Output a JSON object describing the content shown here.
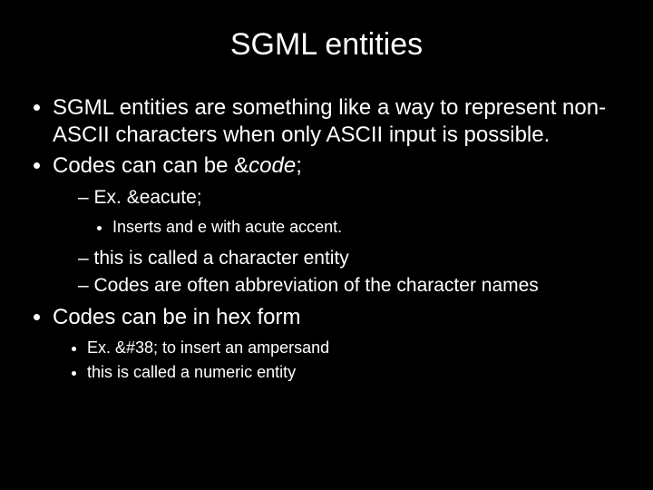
{
  "title": "SGML entities",
  "bullets": {
    "b1": "SGML entities are something like a way to represent non-ASCII characters when only ASCII input is possible.",
    "b2_prefix": "Codes can can be  &",
    "b2_code": "code",
    "b2_suffix": ";",
    "b2_sub1": "Ex. &eacute;",
    "b2_sub1_sub1": "Inserts and e with acute accent.",
    "b2_sub2": "this is called a character entity",
    "b2_sub3": "Codes are often abbreviation of the character names",
    "b3": "Codes can be in hex form",
    "b3_sub1": "Ex. &#38; to insert an ampersand",
    "b3_sub2": "this is called a numeric entity"
  }
}
